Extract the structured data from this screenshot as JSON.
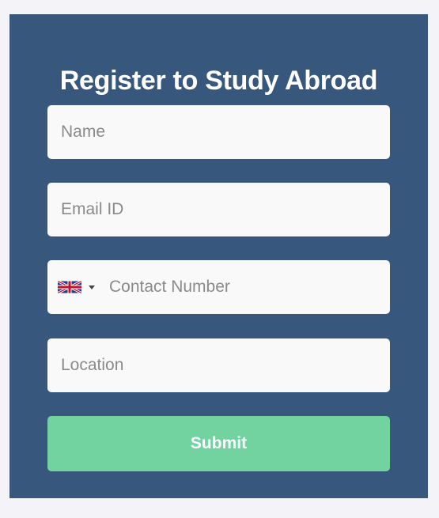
{
  "form": {
    "title": "Register to Study Abroad",
    "name_placeholder": "Name",
    "email_placeholder": "Email ID",
    "phone_placeholder": "Contact Number",
    "phone_country_icon": "uk-flag-icon",
    "location_placeholder": "Location",
    "submit_label": "Submit"
  },
  "colors": {
    "page_background": "#f4f3f8",
    "card_background": "#38577c",
    "input_background": "#faf9fa",
    "submit_background": "#72d3a1",
    "title_text": "#ffffff"
  }
}
